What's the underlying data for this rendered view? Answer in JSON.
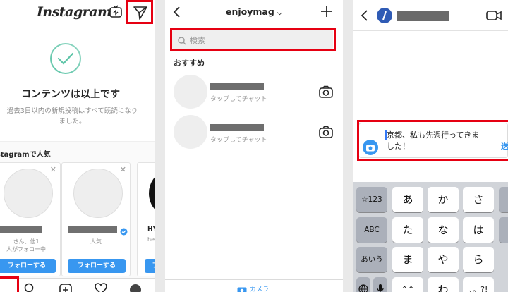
{
  "panel1": {
    "logo": "Instagram",
    "caught_up_title": "コンテンツは以上です",
    "caught_up_line1": "過去3日以内の新規投稿はすべて既読になり",
    "caught_up_line2": "ました。",
    "suggestions_title": "Instagramで人気",
    "cards": [
      {
        "meta1": "さん、他1",
        "meta2": "人がフォロー中",
        "follow": "フォローする"
      },
      {
        "meta1": "人気",
        "meta2": "",
        "follow": "フォローする"
      },
      {
        "name": "HY",
        "meta1": "he",
        "follow": "フ"
      }
    ]
  },
  "panel2": {
    "title": "enjoymag",
    "search_placeholder": "検索",
    "section": "おすすめ",
    "chats": [
      {
        "sub": "タップしてチャット"
      },
      {
        "sub": "タップしてチャット"
      }
    ],
    "footer_label": "カメラ"
  },
  "panel3": {
    "message_line1": "京都、私も先週行ってきま",
    "message_line2": "した！",
    "send": "送",
    "keys": {
      "num": "☆123",
      "abc": "ABC",
      "aiu": "あいう",
      "a": "あ",
      "ka": "か",
      "sa": "さ",
      "ta": "た",
      "na": "な",
      "ha": "は",
      "ma": "ま",
      "ya": "や",
      "ra": "ら",
      "wa": "わ",
      "small": "^^",
      "punct": "、。?!"
    }
  },
  "colors": {
    "accent": "#3897f0",
    "highlight": "#e60012"
  }
}
